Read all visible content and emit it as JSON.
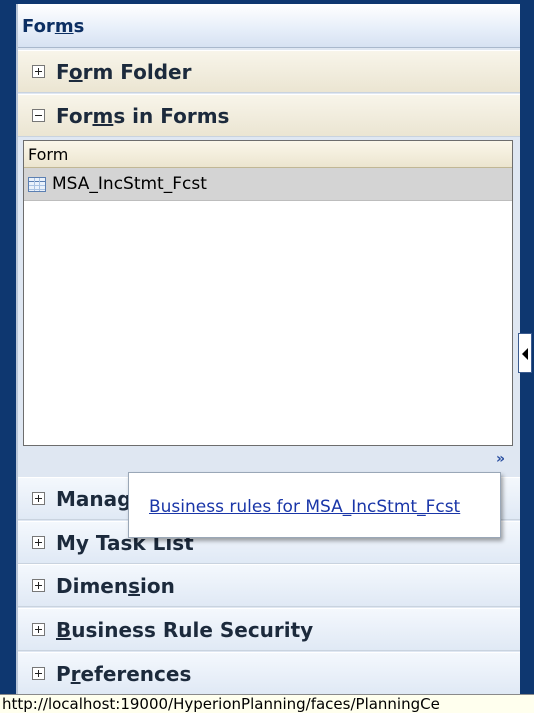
{
  "header": {
    "title_pre": "For",
    "title_u": "m",
    "title_post": "s"
  },
  "accordion": {
    "form_folder": {
      "pre": "F",
      "u": "o",
      "post": "rm Folder",
      "state": "collapsed"
    },
    "forms_in_forms": {
      "pre": "For",
      "u": "m",
      "post": "s in Forms",
      "state": "expanded"
    },
    "manage": {
      "text": "Manag",
      "state": "collapsed"
    },
    "my_task_list": {
      "text": "My Task List",
      "state": "collapsed"
    },
    "dimension": {
      "pre": "Dimen",
      "u": "s",
      "post": "ion",
      "state": "collapsed"
    },
    "business_rule_security": {
      "pre": "",
      "u": "B",
      "post": "usiness Rule Security",
      "state": "collapsed"
    },
    "preferences": {
      "pre": "P",
      "u": "r",
      "post": "eferences",
      "state": "collapsed"
    }
  },
  "forms_list": {
    "column_header": "Form",
    "rows": [
      {
        "label": "MSA_IncStmt_Fcst",
        "icon": "grid-form-icon",
        "selected": true
      }
    ]
  },
  "popup": {
    "link_text": "Business rules for MSA_IncStmt_Fcst"
  },
  "status_bar": {
    "text": "http://localhost:19000/HyperionPlanning/faces/PlanningCe"
  },
  "icons": {
    "more": "double-chevron-down-icon",
    "collapse_tab": "triangle-left-icon"
  },
  "colors": {
    "background": "#0e3770",
    "link": "#1a36a8",
    "selected_row": "#d4d4d4"
  }
}
